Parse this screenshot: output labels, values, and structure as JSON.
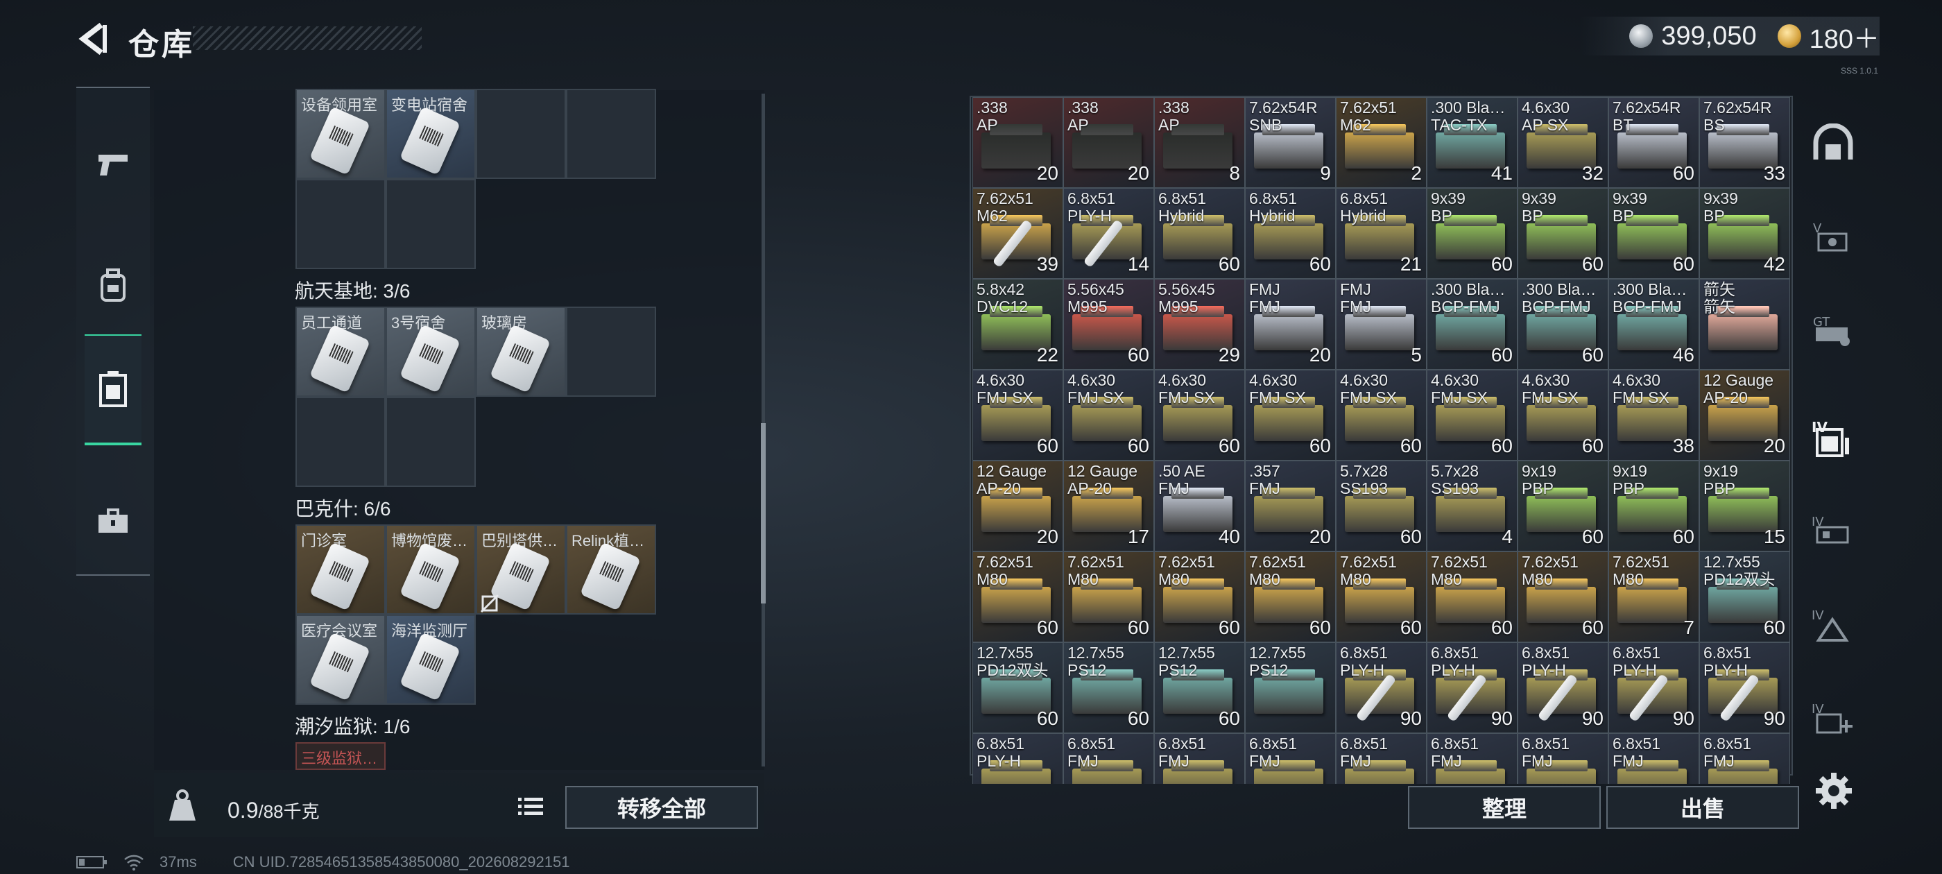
{
  "header": {
    "title": "仓库",
    "currency_silver": "399,050",
    "currency_gold": "180＋",
    "version": "SSS 1.0.1"
  },
  "colors": {
    "accent": "#39d6a1",
    "ap_bg": "#4e2a2c",
    "ammo_bg": "#2f3646",
    "tan_bg": "#4b3d28"
  },
  "side_nav": [
    {
      "icon": "pistol-icon"
    },
    {
      "icon": "backpack-icon"
    },
    {
      "icon": "container-icon"
    },
    {
      "icon": "toolbox-icon"
    }
  ],
  "left": {
    "top_cells": [
      "设备领用室",
      "变电站宿舍"
    ],
    "groups": [
      {
        "title": "航天基地: 3/6",
        "cells": [
          "员工通道",
          "3号宿舍",
          "玻璃房"
        ]
      },
      {
        "title": "巴克什: 6/6",
        "cells": [
          "门诊室",
          "博物馆废…",
          "巴别塔供…",
          "Relink植…",
          "医疗会议室",
          "海洋监测厅"
        ]
      },
      {
        "title": "潮汐监狱: 1/6",
        "cells": [
          "三级监狱…"
        ]
      }
    ],
    "weight_value": "0.9",
    "weight_total": "/88千克",
    "transfer_label": "转移全部"
  },
  "stash": [
    {
      "n": ".338\nAP",
      "c": "20",
      "t": "ap"
    },
    {
      "n": ".338\nAP",
      "c": "20",
      "t": "ap"
    },
    {
      "n": ".338\nAP",
      "c": "8",
      "t": "ap"
    },
    {
      "n": "7.62x54R\nSNB",
      "c": "9",
      "t": "silver"
    },
    {
      "n": "7.62x51\nM62",
      "c": "2",
      "t": "gold"
    },
    {
      "n": ".300 Bla…\nTAC-TX",
      "c": "41",
      "t": "teal"
    },
    {
      "n": "4.6x30\nAP SX",
      "c": "32",
      "t": "olive"
    },
    {
      "n": "7.62x54R\nBT",
      "c": "60",
      "t": "silver"
    },
    {
      "n": "7.62x54R\nBS",
      "c": "33",
      "t": "silver"
    },
    {
      "n": "7.62x51\nM62",
      "c": "39",
      "t": "gold",
      "needle": true
    },
    {
      "n": "6.8x51\nPLY-H",
      "c": "14",
      "t": "olive",
      "needle": true
    },
    {
      "n": "6.8x51\nHybrid",
      "c": "60",
      "t": "olive"
    },
    {
      "n": "6.8x51\nHybrid",
      "c": "60",
      "t": "olive"
    },
    {
      "n": "6.8x51\nHybrid",
      "c": "21",
      "t": "olive"
    },
    {
      "n": "9x39\nBP",
      "c": "60",
      "t": "green"
    },
    {
      "n": "9x39\nBP",
      "c": "60",
      "t": "green"
    },
    {
      "n": "9x39\nBP",
      "c": "60",
      "t": "green"
    },
    {
      "n": "9x39\nBP",
      "c": "42",
      "t": "green"
    },
    {
      "n": "5.8x42\nDVC12",
      "c": "22",
      "t": "green"
    },
    {
      "n": "5.56x45\nM995",
      "c": "60",
      "t": "red"
    },
    {
      "n": "5.56x45\nM995",
      "c": "29",
      "t": "red"
    },
    {
      "n": "FMJ\nFMJ",
      "c": "20",
      "t": "silver"
    },
    {
      "n": "FMJ\nFMJ",
      "c": "5",
      "t": "silver"
    },
    {
      "n": ".300 Bla…\nBCP-FMJ",
      "c": "60",
      "t": "teal"
    },
    {
      "n": ".300 Bla…\nBCP-FMJ",
      "c": "60",
      "t": "teal"
    },
    {
      "n": ".300 Bla…\nBCP-FMJ",
      "c": "46",
      "t": "teal"
    },
    {
      "n": "箭矢\n箭矢",
      "c": "",
      "t": "pink"
    },
    {
      "n": "4.6x30\nFMJ SX",
      "c": "60",
      "t": "olive"
    },
    {
      "n": "4.6x30\nFMJ SX",
      "c": "60",
      "t": "olive"
    },
    {
      "n": "4.6x30\nFMJ SX",
      "c": "60",
      "t": "olive"
    },
    {
      "n": "4.6x30\nFMJ SX",
      "c": "60",
      "t": "olive"
    },
    {
      "n": "4.6x30\nFMJ SX",
      "c": "60",
      "t": "olive"
    },
    {
      "n": "4.6x30\nFMJ SX",
      "c": "60",
      "t": "olive"
    },
    {
      "n": "4.6x30\nFMJ SX",
      "c": "60",
      "t": "olive"
    },
    {
      "n": "4.6x30\nFMJ SX",
      "c": "38",
      "t": "olive"
    },
    {
      "n": "12 Gauge\nAP-20",
      "c": "20",
      "t": "gold"
    },
    {
      "n": "12 Gauge\nAP-20",
      "c": "20",
      "t": "gold"
    },
    {
      "n": "12 Gauge\nAP-20",
      "c": "17",
      "t": "gold"
    },
    {
      "n": ".50 AE\nFMJ",
      "c": "40",
      "t": "silver"
    },
    {
      "n": ".357\nFMJ",
      "c": "20",
      "t": "olive"
    },
    {
      "n": "5.7x28\nSS193",
      "c": "60",
      "t": "olive"
    },
    {
      "n": "5.7x28\nSS193",
      "c": "4",
      "t": "olive"
    },
    {
      "n": "9x19\nPBP",
      "c": "60",
      "t": "green"
    },
    {
      "n": "9x19\nPBP",
      "c": "60",
      "t": "green"
    },
    {
      "n": "9x19\nPBP",
      "c": "15",
      "t": "green"
    },
    {
      "n": "7.62x51\nM80",
      "c": "60",
      "t": "gold"
    },
    {
      "n": "7.62x51\nM80",
      "c": "60",
      "t": "gold"
    },
    {
      "n": "7.62x51\nM80",
      "c": "60",
      "t": "gold"
    },
    {
      "n": "7.62x51\nM80",
      "c": "60",
      "t": "gold"
    },
    {
      "n": "7.62x51\nM80",
      "c": "60",
      "t": "gold"
    },
    {
      "n": "7.62x51\nM80",
      "c": "60",
      "t": "gold"
    },
    {
      "n": "7.62x51\nM80",
      "c": "60",
      "t": "gold"
    },
    {
      "n": "7.62x51\nM80",
      "c": "7",
      "t": "gold"
    },
    {
      "n": "12.7x55\nPD12双头",
      "c": "60",
      "t": "teal"
    },
    {
      "n": "12.7x55\nPD12双头",
      "c": "60",
      "t": "teal"
    },
    {
      "n": "12.7x55\nPS12",
      "c": "60",
      "t": "teal"
    },
    {
      "n": "12.7x55\nPS12",
      "c": "60",
      "t": "teal"
    },
    {
      "n": "12.7x55\nPS12",
      "c": "",
      "t": "teal"
    },
    {
      "n": "6.8x51\nPLY-H",
      "c": "90",
      "t": "olive",
      "needle": true
    },
    {
      "n": "6.8x51\nPLY-H",
      "c": "90",
      "t": "olive",
      "needle": true
    },
    {
      "n": "6.8x51\nPLY-H",
      "c": "90",
      "t": "olive",
      "needle": true
    },
    {
      "n": "6.8x51\nPLY-H",
      "c": "90",
      "t": "olive",
      "needle": true
    },
    {
      "n": "6.8x51\nPLY-H",
      "c": "90",
      "t": "olive",
      "needle": true
    },
    {
      "n": "6.8x51\nPLY-H",
      "c": "",
      "t": "olive"
    },
    {
      "n": "6.8x51\nFMJ",
      "c": "",
      "t": "olive"
    },
    {
      "n": "6.8x51\nFMJ",
      "c": "",
      "t": "olive"
    },
    {
      "n": "6.8x51\nFMJ",
      "c": "",
      "t": "olive"
    },
    {
      "n": "6.8x51\nFMJ",
      "c": "",
      "t": "olive"
    },
    {
      "n": "6.8x51\nFMJ",
      "c": "",
      "t": "olive"
    },
    {
      "n": "6.8x51\nFMJ",
      "c": "",
      "t": "olive"
    },
    {
      "n": "6.8x51\nFMJ",
      "c": "",
      "t": "olive"
    },
    {
      "n": "6.8x51\nFMJ",
      "c": "",
      "t": "olive"
    }
  ],
  "right_nav": [
    "shelter-icon",
    "stash-v-icon",
    "stash-gt-icon",
    "stash-iv-active-icon",
    "stash-iv-icon",
    "stash-iv-alt-icon",
    "stash-iv-add-icon"
  ],
  "actions": {
    "sort_label": "整理",
    "sell_label": "出售"
  },
  "status": {
    "ping": "37ms",
    "uid": "CN UID.72854651358543850080_202608292151"
  }
}
